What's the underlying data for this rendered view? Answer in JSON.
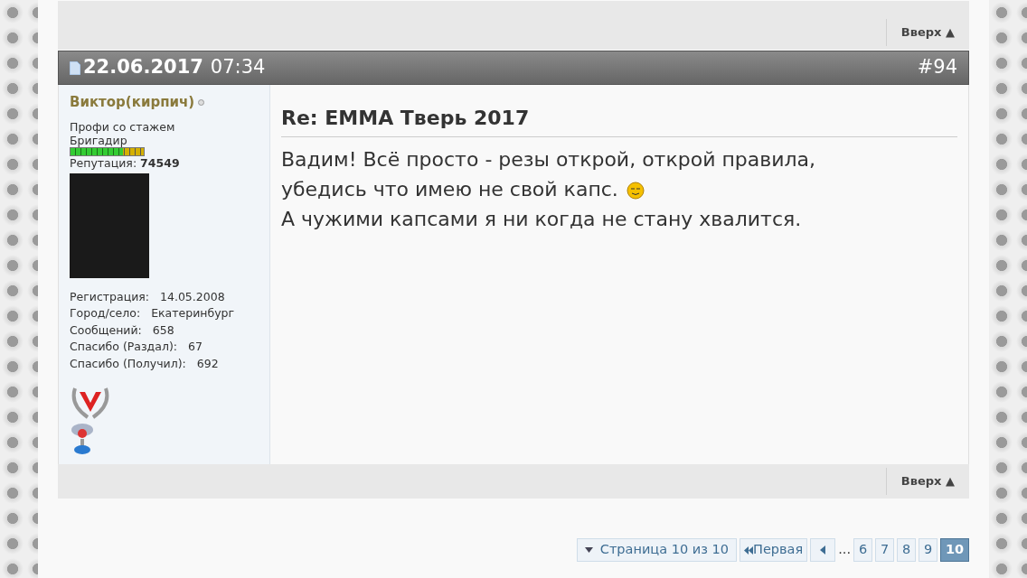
{
  "prev_post_footer": {
    "top_link": "Вверх ▲"
  },
  "post": {
    "date": "22.06.2017",
    "time": "07:34",
    "number": "#94",
    "user": {
      "name": "Виктор(кирпич)",
      "online": false,
      "title": "Профи со стажем",
      "rank": "Бригадир",
      "reputation_label": "Репутация:",
      "reputation": "74549",
      "reputation_bar": {
        "level": 0.71
      },
      "details": [
        {
          "label": "Регистрация:",
          "value": "14.05.2008"
        },
        {
          "label": "Город/село:",
          "value": "Екатеринбург"
        },
        {
          "label": "Сообщений:",
          "value": "658"
        },
        {
          "label": "Спасибо (Раздал):",
          "value": "67"
        },
        {
          "label": "Спасибо (Получил):",
          "value": "692"
        }
      ]
    },
    "title": "Re: EMMA Тверь 2017",
    "lines": [
      {
        "text": "Вадим! Всё просто - резы открой, открой правила,",
        "smiley": false
      },
      {
        "text": "убедись что имею не свой капс.",
        "smiley": true
      },
      {
        "text": "А чужими капсами я ни когда не стану хвалится.",
        "smiley": false
      }
    ],
    "top_link": "Вверх ▲"
  },
  "pagination": {
    "page_label": "Страница 10 из 10",
    "first": "Первая",
    "ellipsis": "...",
    "pages": [
      {
        "label": "6",
        "selected": false
      },
      {
        "label": "7",
        "selected": false
      },
      {
        "label": "8",
        "selected": false
      },
      {
        "label": "9",
        "selected": false
      },
      {
        "label": "10",
        "selected": true
      }
    ]
  }
}
